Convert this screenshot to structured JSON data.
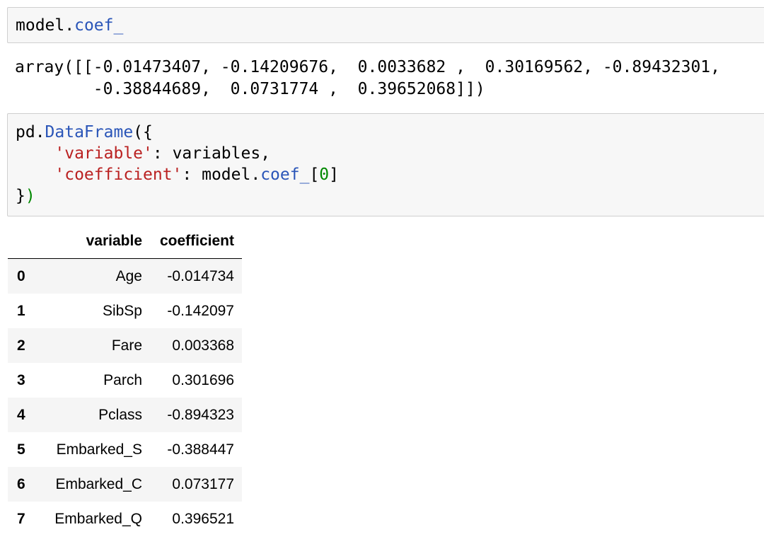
{
  "cell1": {
    "prefix": "model.",
    "attr": "coef_"
  },
  "output": {
    "line1": "array([[-0.01473407, -0.14209676,  0.0033682 ,  0.30169562, -0.89432301,",
    "line2": "        -0.38844689,  0.0731774 ,  0.39652068]])"
  },
  "cell2": {
    "l1_prefix": "pd.",
    "l1_attr": "DataFrame",
    "l1_paren": "({",
    "l2_indent": "    ",
    "l2_str": "'variable'",
    "l2_rest": ": variables,",
    "l3_indent": "    ",
    "l3_str": "'coefficient'",
    "l3_rest1": ": model.",
    "l3_attr": "coef_",
    "l3_bracket_open": "[",
    "l3_num": "0",
    "l3_bracket_close": "]",
    "l4_brace": "}",
    "l4_paren": ")"
  },
  "table": {
    "columns": [
      "variable",
      "coefficient"
    ],
    "rows": [
      {
        "index": "0",
        "variable": "Age",
        "coefficient": "-0.014734"
      },
      {
        "index": "1",
        "variable": "SibSp",
        "coefficient": "-0.142097"
      },
      {
        "index": "2",
        "variable": "Fare",
        "coefficient": "0.003368"
      },
      {
        "index": "3",
        "variable": "Parch",
        "coefficient": "0.301696"
      },
      {
        "index": "4",
        "variable": "Pclass",
        "coefficient": "-0.894323"
      },
      {
        "index": "5",
        "variable": "Embarked_S",
        "coefficient": "-0.388447"
      },
      {
        "index": "6",
        "variable": "Embarked_C",
        "coefficient": "0.073177"
      },
      {
        "index": "7",
        "variable": "Embarked_Q",
        "coefficient": "0.396521"
      }
    ]
  }
}
